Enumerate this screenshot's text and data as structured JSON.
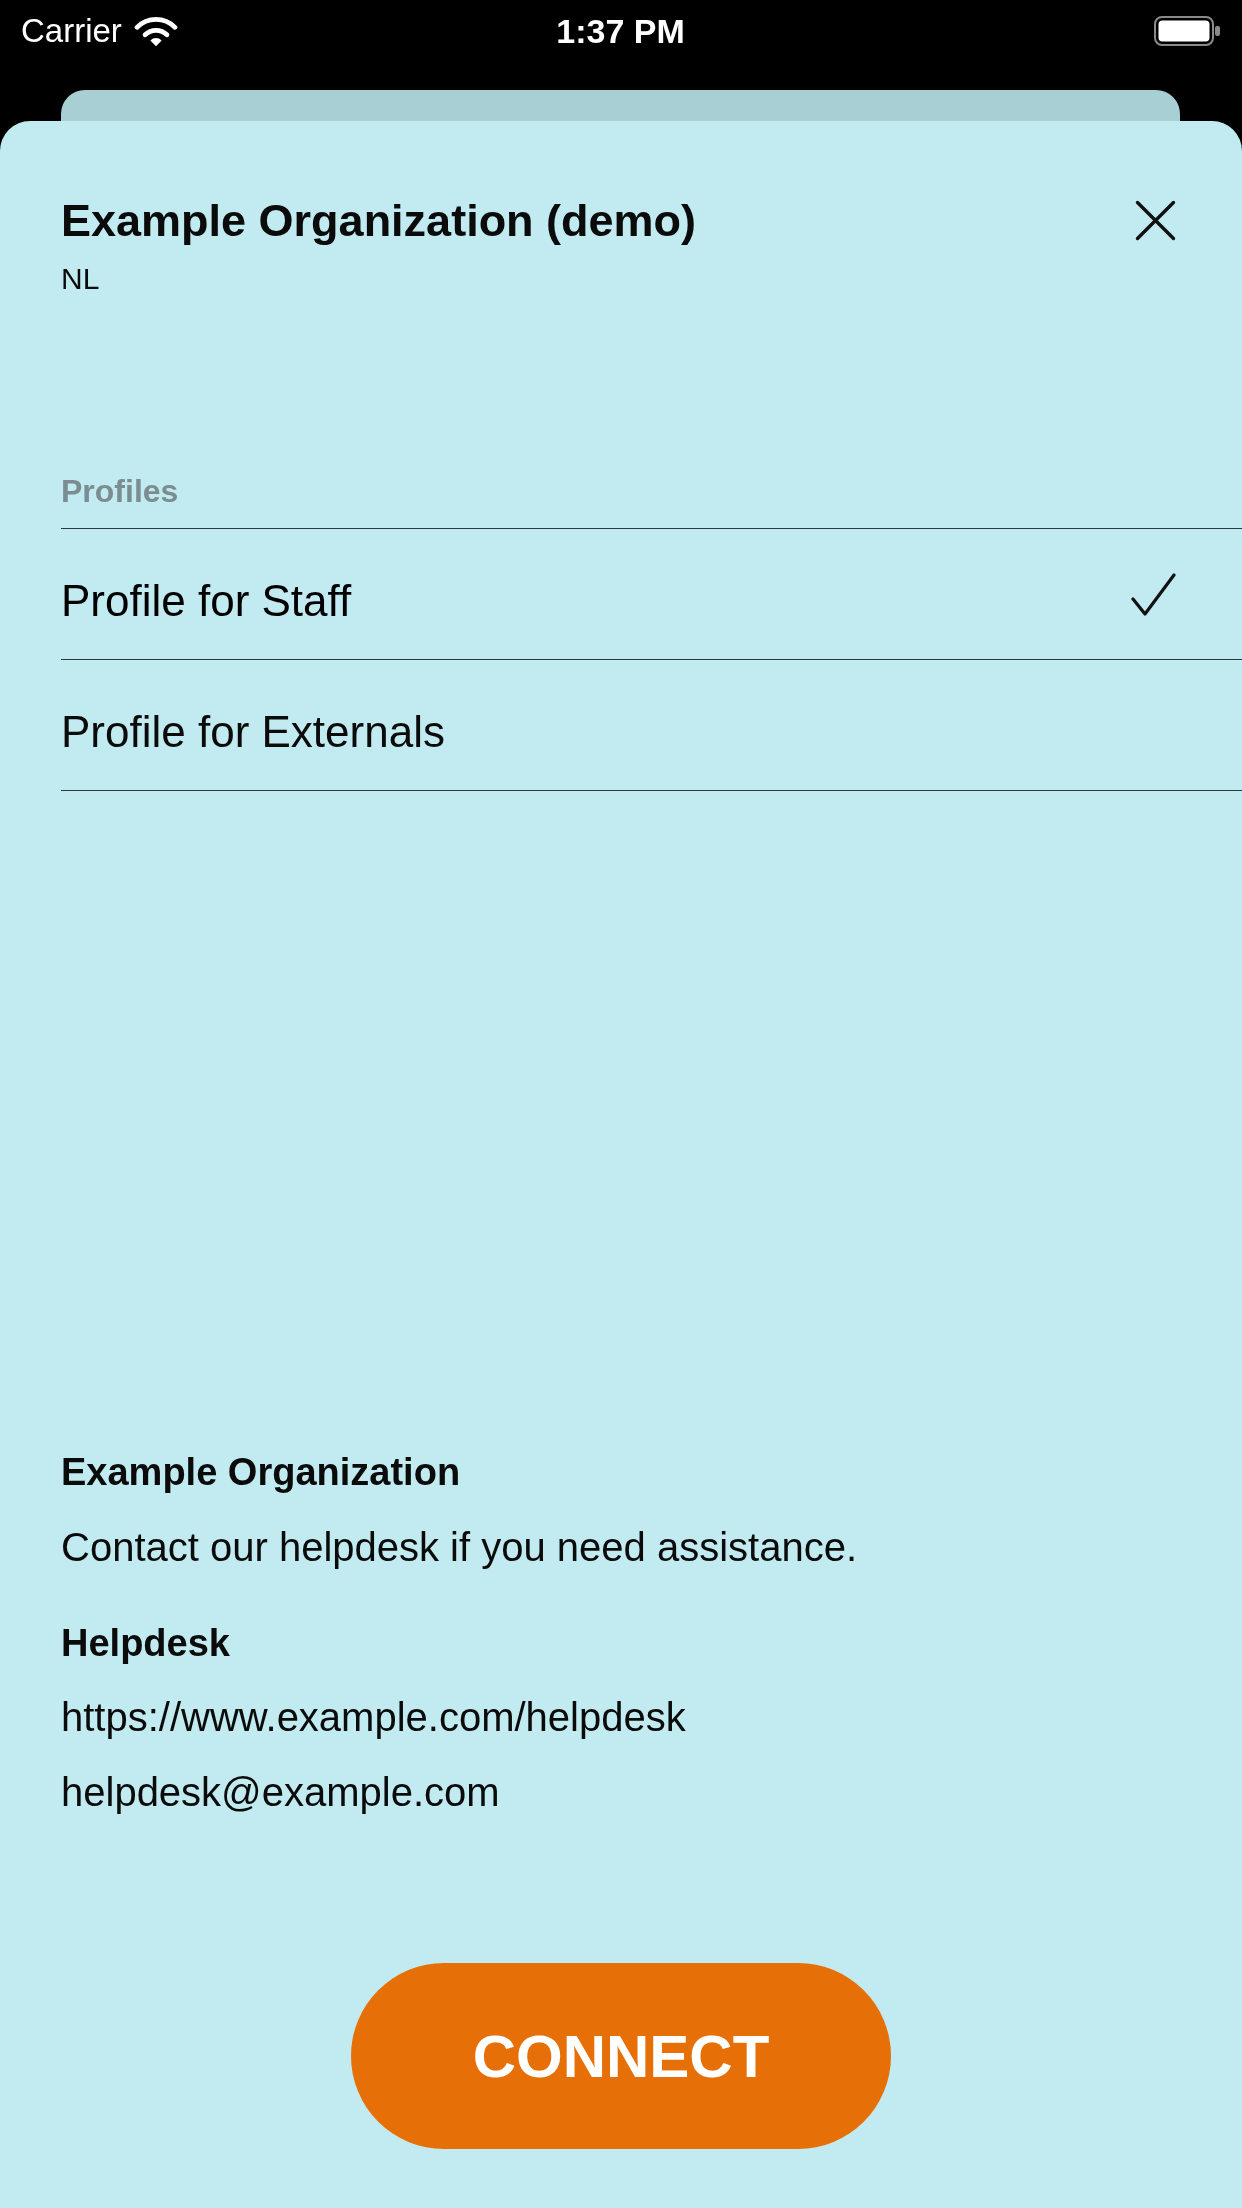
{
  "status_bar": {
    "carrier": "Carrier",
    "time": "1:37 PM"
  },
  "sheet": {
    "title": "Example Organization (demo)",
    "subtitle": "NL"
  },
  "profiles": {
    "heading": "Profiles",
    "items": [
      {
        "label": "Profile for Staff",
        "selected": true
      },
      {
        "label": "Profile for Externals",
        "selected": false
      }
    ]
  },
  "support": {
    "organization": "Example Organization",
    "message": "Contact our helpdesk if you need assistance.",
    "helpdesk_heading": "Helpdesk",
    "contacts": [
      "https://www.example.com/helpdesk",
      "helpdesk@example.com"
    ]
  },
  "button": {
    "label": "CONNECT"
  }
}
